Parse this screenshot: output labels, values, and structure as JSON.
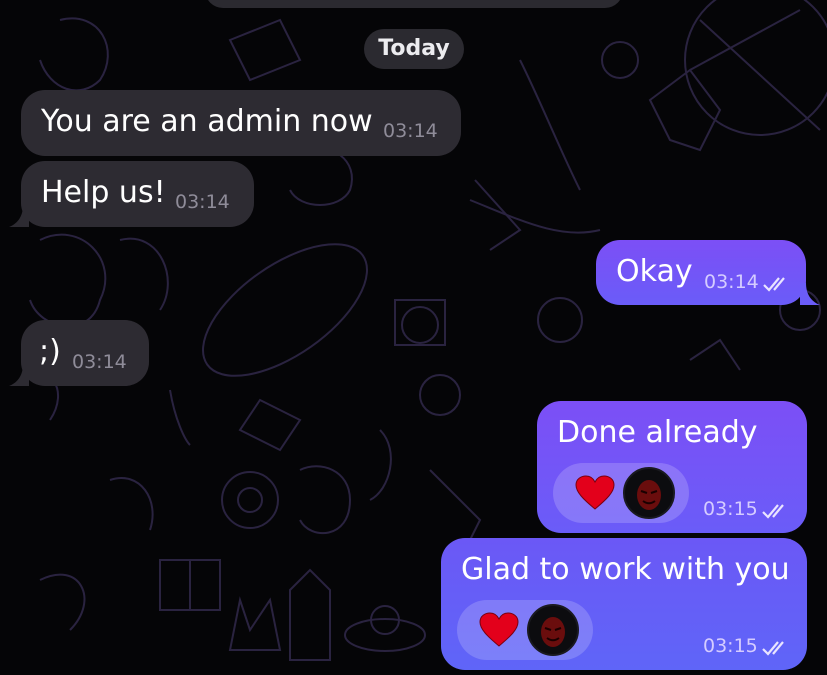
{
  "chat": {
    "date_label": "Today",
    "messages": [
      {
        "direction": "incoming",
        "text": "You are an admin now",
        "time": "03:14"
      },
      {
        "direction": "incoming",
        "text": "Help us!",
        "time": "03:14"
      },
      {
        "direction": "outgoing",
        "text": "Okay",
        "time": "03:14",
        "status": "read"
      },
      {
        "direction": "incoming",
        "text": ";)",
        "time": "03:14"
      },
      {
        "direction": "outgoing",
        "text": "Done already",
        "time": "03:15",
        "status": "read",
        "reaction": "heart-icon"
      },
      {
        "direction": "outgoing",
        "text": "Glad to work with you",
        "time": "03:15",
        "status": "read",
        "reaction": "heart-icon"
      }
    ]
  },
  "colors": {
    "background": "#050507",
    "incoming_bubble": "#2d2b32",
    "outgoing_bubble_top": "#7c4ff6",
    "outgoing_bubble_bottom": "#5f65f8",
    "heart": "#e3001b"
  }
}
